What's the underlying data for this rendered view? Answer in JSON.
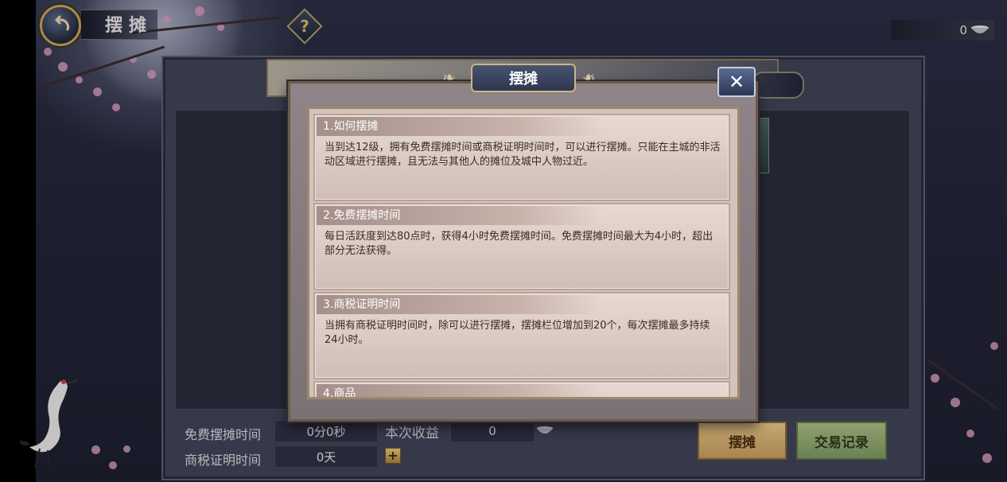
{
  "header": {
    "title": "摆摊",
    "help_symbol": "?"
  },
  "currency": {
    "amount": "0",
    "icon": "bowl-icon"
  },
  "bottom": {
    "free_time_label": "免费摆摊时间",
    "free_time_value": "0分0秒",
    "income_label": "本次收益",
    "income_value": "0",
    "tax_label": "商税证明时间",
    "tax_value": "0天",
    "plus_label": "+"
  },
  "buttons": {
    "stall": "摆摊",
    "records": "交易记录"
  },
  "modal": {
    "title": "摆摊",
    "close_symbol": "✕",
    "sections": [
      {
        "heading": "1.如何摆摊",
        "body": "当到达12级，拥有免费摆摊时间或商税证明时间时，可以进行摆摊。只能在主城的非活动区域进行摆摊，且无法与其他人的摊位及城中人物过近。"
      },
      {
        "heading": "2.免费摆摊时间",
        "body": "每日活跃度到达80点时，获得4小时免费摆摊时间。免费摆摊时间最大为4小时，超出部分无法获得。"
      },
      {
        "heading": "3.商税证明时间",
        "body": "当拥有商税证明时间时，除可以进行摆摊，摆摊栏位增加到20个，每次摆摊最多持续24小时。"
      },
      {
        "heading": "4.商品"
      }
    ]
  },
  "colors": {
    "stall_button": "#d8b676",
    "record_button": "#95ac73",
    "modal_paper": "#d4c2bc"
  }
}
